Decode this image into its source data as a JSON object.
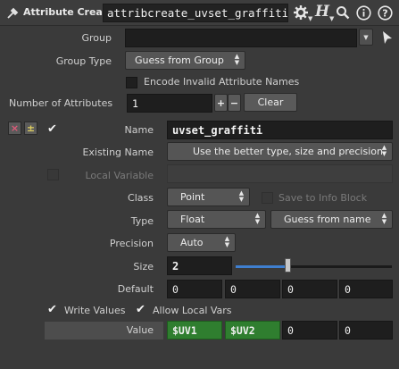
{
  "header": {
    "node_type": "Attribute Create",
    "node_name": "attribcreate_uvset_graffiti"
  },
  "params": {
    "group_label": "Group",
    "group_value": "",
    "group_type_label": "Group Type",
    "group_type_value": "Guess from Group",
    "encode_label": "Encode Invalid Attribute Names",
    "num_attr_label": "Number of Attributes",
    "num_attr_value": "1",
    "plus": "+",
    "minus": "−",
    "clear": "Clear"
  },
  "attribute": {
    "name_label": "Name",
    "name_value": "uvset_graffiti",
    "existing_label": "Existing Name",
    "existing_value": "Use the better type, size and precision",
    "local_var_label": "Local Variable",
    "local_var_value": "",
    "class_label": "Class",
    "class_value": "Point",
    "save_info_label": "Save to Info Block",
    "type_label": "Type",
    "type_value": "Float",
    "typeinfo_value": "Guess from name",
    "precision_label": "Precision",
    "precision_value": "Auto",
    "size_label": "Size",
    "size_value": "2",
    "size_slider_fraction": 0.34,
    "default_label": "Default",
    "default_values": [
      "0",
      "0",
      "0",
      "0"
    ],
    "write_values_label": "Write Values",
    "allow_local_label": "Allow Local Vars",
    "value_label": "Value",
    "value_values": [
      "$UV1",
      "$UV2",
      "0",
      "0"
    ]
  }
}
